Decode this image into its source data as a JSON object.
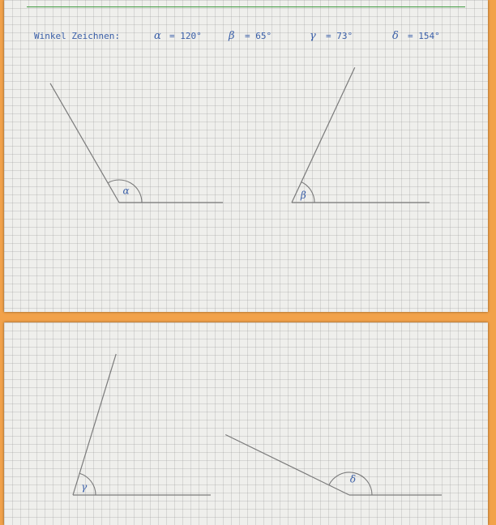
{
  "header": {
    "title": "Winkel Zeichnen:",
    "angles": [
      {
        "symbol": "α",
        "label": "= 120°"
      },
      {
        "symbol": "β",
        "label": "= 65°"
      },
      {
        "symbol": "γ",
        "label": "= 73°"
      },
      {
        "symbol": "δ",
        "label": "= 154°"
      }
    ]
  },
  "colors": {
    "ink": "#3a5fa8",
    "rule": "#3f9a3f",
    "line": "#7a7a7a",
    "frame": "#f2a24a"
  },
  "angles": [
    {
      "symbol": "α",
      "degrees": 120
    },
    {
      "symbol": "β",
      "degrees": 65
    },
    {
      "symbol": "γ",
      "degrees": 73
    },
    {
      "symbol": "δ",
      "degrees": 154
    }
  ]
}
